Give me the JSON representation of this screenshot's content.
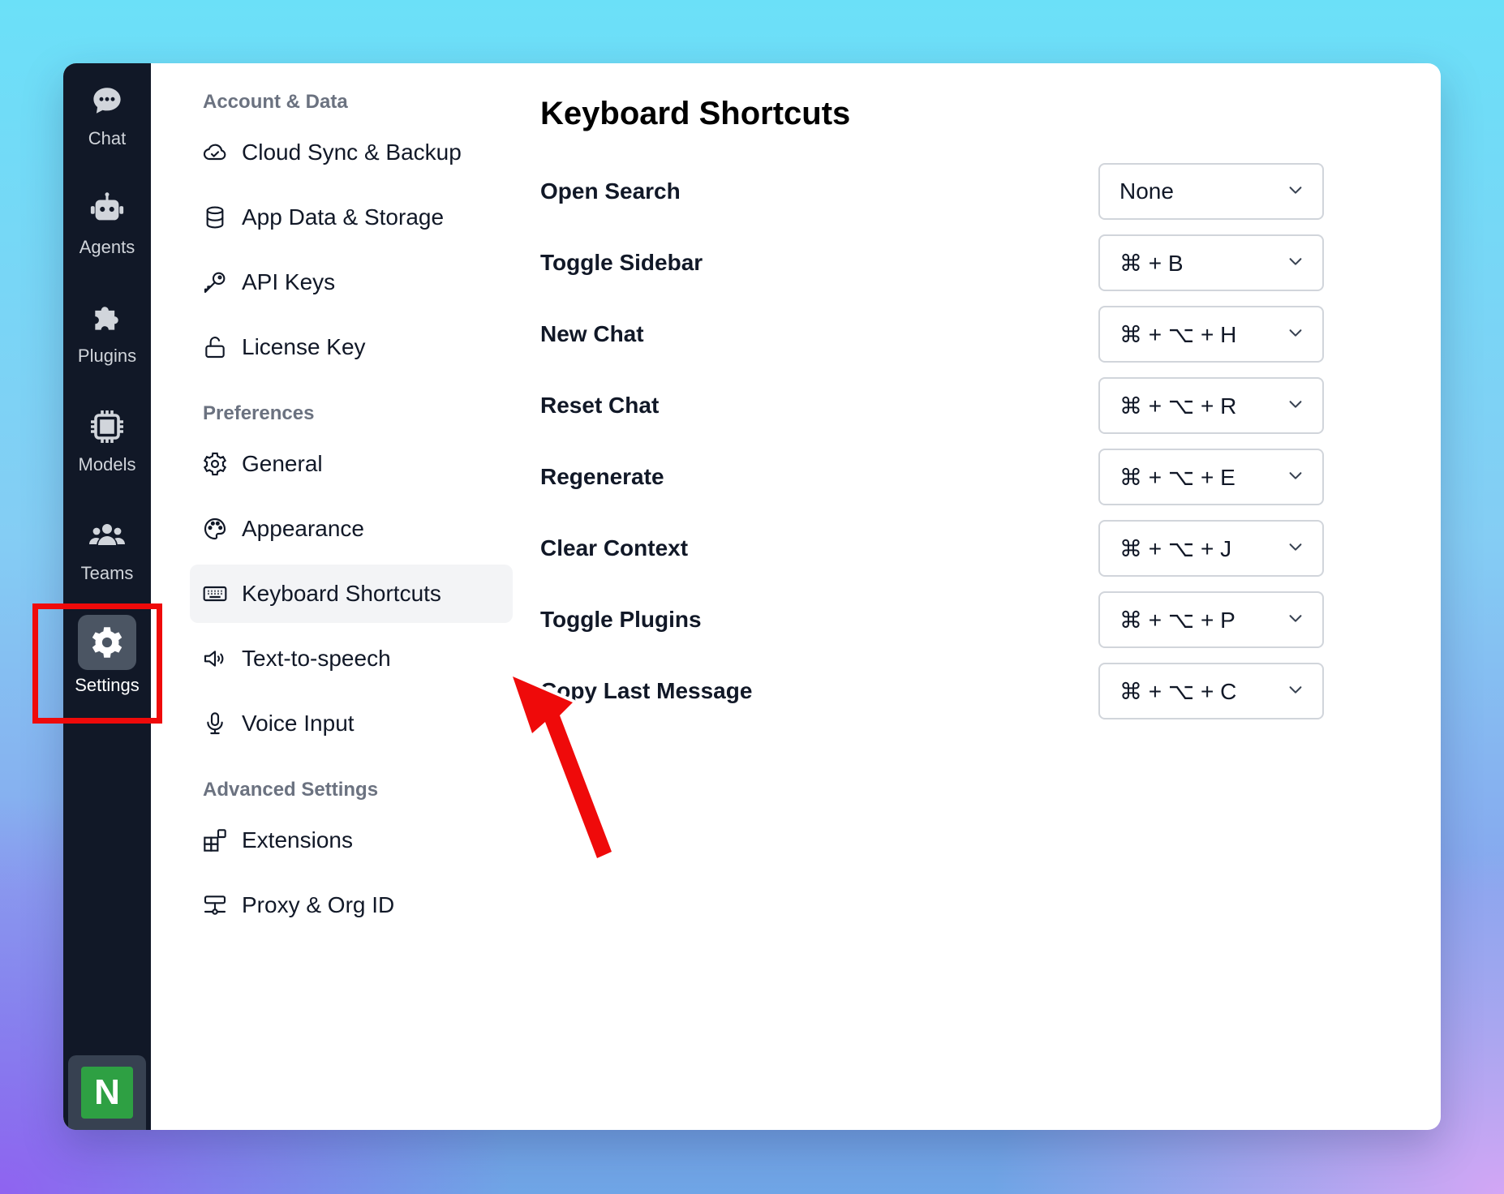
{
  "rail": {
    "items": [
      {
        "label": "Chat",
        "icon": "chat-bubble-icon"
      },
      {
        "label": "Agents",
        "icon": "robot-icon"
      },
      {
        "label": "Plugins",
        "icon": "puzzle-icon"
      },
      {
        "label": "Models",
        "icon": "chip-icon"
      },
      {
        "label": "Teams",
        "icon": "users-icon"
      },
      {
        "label": "Settings",
        "icon": "gear-icon",
        "active": true
      }
    ],
    "badge": "N"
  },
  "nav": {
    "sections": [
      {
        "title": "Account & Data",
        "items": [
          {
            "label": "Cloud Sync & Backup",
            "icon": "cloud-icon"
          },
          {
            "label": "App Data & Storage",
            "icon": "database-icon"
          },
          {
            "label": "API Keys",
            "icon": "key-icon"
          },
          {
            "label": "License Key",
            "icon": "unlock-icon"
          }
        ]
      },
      {
        "title": "Preferences",
        "items": [
          {
            "label": "General",
            "icon": "gear-icon"
          },
          {
            "label": "Appearance",
            "icon": "palette-icon"
          },
          {
            "label": "Keyboard Shortcuts",
            "icon": "keyboard-icon",
            "active": true
          },
          {
            "label": "Text-to-speech",
            "icon": "speaker-icon"
          },
          {
            "label": "Voice Input",
            "icon": "microphone-icon"
          }
        ]
      },
      {
        "title": "Advanced Settings",
        "items": [
          {
            "label": "Extensions",
            "icon": "extensions-icon"
          },
          {
            "label": "Proxy & Org ID",
            "icon": "proxy-icon"
          }
        ]
      }
    ]
  },
  "main": {
    "title": "Keyboard Shortcuts",
    "shortcuts": [
      {
        "label": "Open Search",
        "value": "None"
      },
      {
        "label": "Toggle Sidebar",
        "value": "⌘ + B"
      },
      {
        "label": "New Chat",
        "value": "⌘ + ⌥ + H"
      },
      {
        "label": "Reset Chat",
        "value": "⌘ + ⌥ + R"
      },
      {
        "label": "Regenerate",
        "value": "⌘ + ⌥ + E"
      },
      {
        "label": "Clear Context",
        "value": "⌘ + ⌥ + J"
      },
      {
        "label": "Toggle Plugins",
        "value": "⌘ + ⌥ + P"
      },
      {
        "label": "Copy Last Message",
        "value": "⌘ + ⌥ + C"
      }
    ]
  },
  "annotation": {
    "color": "#ef0a0a"
  }
}
